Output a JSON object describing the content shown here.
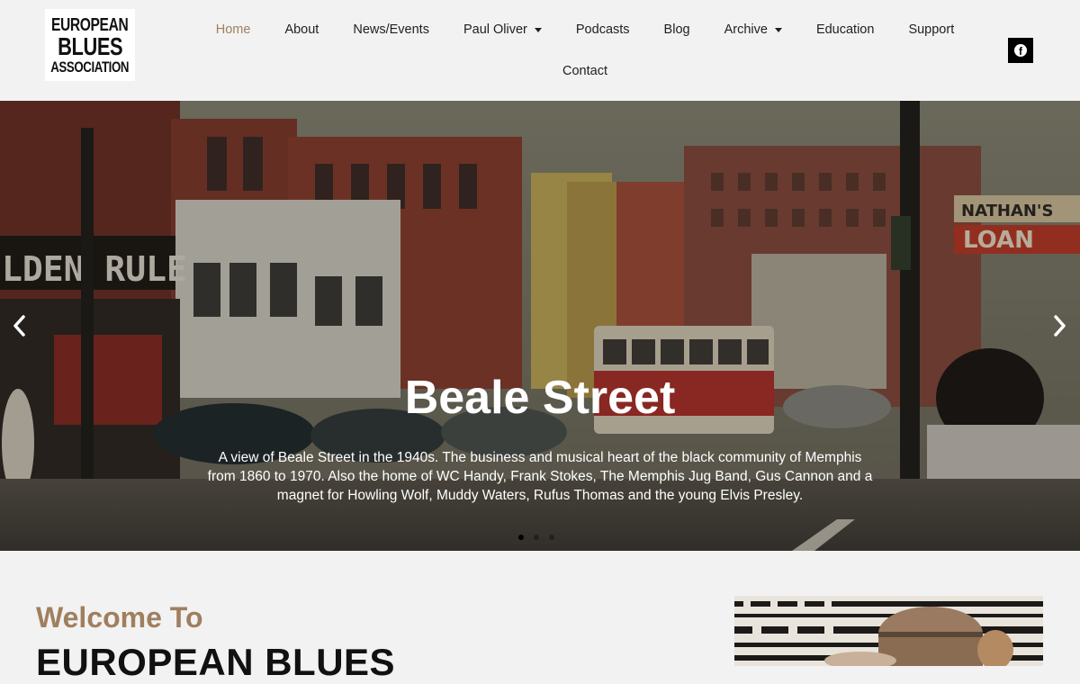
{
  "logo": {
    "line1": "EUROPEAN",
    "line2": "BLUES",
    "line3": "ASSOCIATION"
  },
  "nav": {
    "row1": [
      {
        "label": "Home",
        "active": true,
        "dropdown": false
      },
      {
        "label": "About",
        "active": false,
        "dropdown": false
      },
      {
        "label": "News/Events",
        "active": false,
        "dropdown": false
      },
      {
        "label": "Paul Oliver",
        "active": false,
        "dropdown": true
      },
      {
        "label": "Podcasts",
        "active": false,
        "dropdown": false
      },
      {
        "label": "Blog",
        "active": false,
        "dropdown": false
      },
      {
        "label": "Archive",
        "active": false,
        "dropdown": true
      },
      {
        "label": "Education",
        "active": false,
        "dropdown": false
      },
      {
        "label": "Support",
        "active": false,
        "dropdown": false
      }
    ],
    "row2": [
      {
        "label": "Contact",
        "active": false,
        "dropdown": false
      }
    ]
  },
  "social": {
    "facebook_icon": "facebook-icon",
    "facebook_glyph": "f"
  },
  "hero": {
    "title": "Beale Street",
    "description": "A view of Beale Street in the 1940s. The business and musical heart of the black community of Memphis from 1860 to 1970. Also the home of WC Handy, Frank Stokes, The Memphis Jug Band, Gus Cannon and a magnet for Howling Wolf, Muddy Waters, Rufus Thomas and the young Elvis Presley.",
    "signs": {
      "left": "LDEN RULE",
      "nathans": "NATHAN'S",
      "loan": "LOAN"
    },
    "slide_count": 3,
    "active_slide": 1
  },
  "welcome": {
    "subtitle": "Welcome To",
    "title": "EUROPEAN BLUES"
  },
  "colors": {
    "accent": "#a07f5f",
    "text": "#1f1f1f",
    "background": "#f2f2f2"
  }
}
